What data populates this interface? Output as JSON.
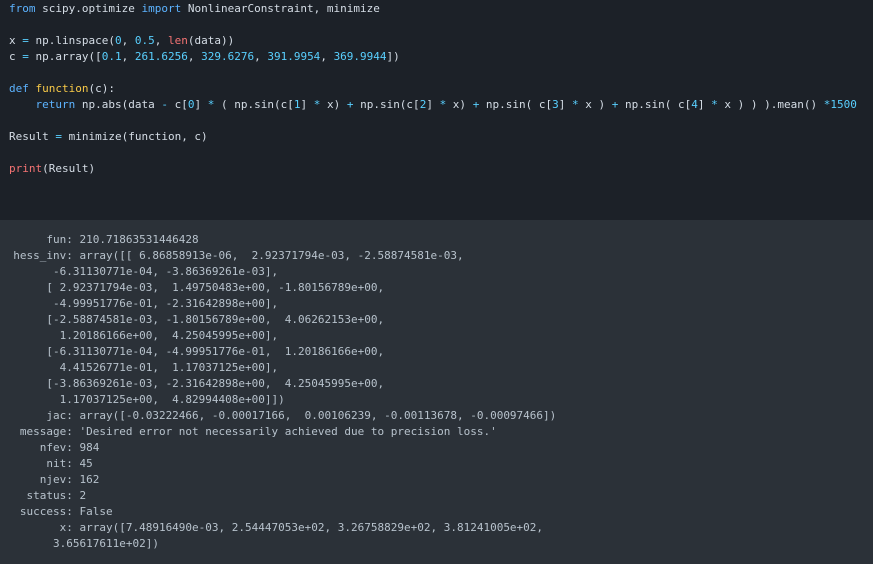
{
  "code": {
    "import_from_kw": "from",
    "import_module": " scipy.optimize ",
    "import_kw": "import",
    "import_names": " NonlinearConstraint, minimize",
    "x_prefix": "x ",
    "x_eq": "=",
    "x_mid": " np.linspace(",
    "x_a0": "0",
    "x_sep1": ", ",
    "x_a1": "0.5",
    "x_sep2": ", ",
    "x_len": "len",
    "x_end": "(data))",
    "c_prefix": "c ",
    "c_eq": "=",
    "c_mid": " np.array([",
    "c_v0": "0.1",
    "c_s0": ", ",
    "c_v1": "261.6256",
    "c_s1": ", ",
    "c_v2": "329.6276",
    "c_s2": ", ",
    "c_v3": "391.9954",
    "c_s3": ", ",
    "c_v4": "369.9944",
    "c_end": "])",
    "def_kw": "def",
    "def_space": " ",
    "def_name": "function",
    "def_args": "(c):",
    "ret_indent": "    ",
    "ret_kw": "return",
    "ret_t1": " np.abs(data ",
    "ret_minus": "-",
    "ret_t2": " c[",
    "ret_i0": "0",
    "ret_t3": "] ",
    "ret_mul1": "*",
    "ret_t4": " ( np.sin(c[",
    "ret_i1": "1",
    "ret_t5": "] ",
    "ret_mul2": "*",
    "ret_t6": " x) ",
    "ret_plus1": "+",
    "ret_t7": " np.sin(c[",
    "ret_i2": "2",
    "ret_t8": "] ",
    "ret_mul3": "*",
    "ret_t9": " x) ",
    "ret_plus2": "+",
    "ret_t10": " np.sin( c[",
    "ret_i3": "3",
    "ret_t11": "] ",
    "ret_mul4": "*",
    "ret_t12": " x ) ",
    "ret_plus3": "+",
    "ret_t13": " np.sin( c[",
    "ret_i4": "4",
    "ret_t14": "] ",
    "ret_mul5": "*",
    "ret_t15": " x ) ) ).mean() ",
    "ret_mul6": "*",
    "ret_scale": "1500",
    "res_prefix": "Result ",
    "res_eq": "=",
    "res_call": " minimize(function, c)",
    "print_kw": "print",
    "print_arg": "(Result)"
  },
  "output": {
    "lines": [
      "       fun: 210.71863531446428",
      "  hess_inv: array([[ 6.86858913e-06,  2.92371794e-03, -2.58874581e-03,",
      "        -6.31130771e-04, -3.86369261e-03],",
      "       [ 2.92371794e-03,  1.49750483e+00, -1.80156789e+00,",
      "        -4.99951776e-01, -2.31642898e+00],",
      "       [-2.58874581e-03, -1.80156789e+00,  4.06262153e+00,",
      "         1.20186166e+00,  4.25045995e+00],",
      "       [-6.31130771e-04, -4.99951776e-01,  1.20186166e+00,",
      "         4.41526771e-01,  1.17037125e+00],",
      "       [-3.86369261e-03, -2.31642898e+00,  4.25045995e+00,",
      "         1.17037125e+00,  4.82994408e+00]])",
      "       jac: array([-0.03222466, -0.00017166,  0.00106239, -0.00113678, -0.00097466])",
      "   message: 'Desired error not necessarily achieved due to precision loss.'",
      "      nfev: 984",
      "       nit: 45",
      "      njev: 162",
      "    status: 2",
      "   success: False",
      "         x: array([7.48916490e-03, 2.54447053e+02, 3.26758829e+02, 3.81241005e+02,",
      "        3.65617611e+02])"
    ]
  },
  "colors": {
    "code_bg": "#1c2128",
    "output_bg": "#2b3138",
    "keyword": "#5cb3ff",
    "function_name": "#f7c948",
    "number": "#59d0ff",
    "builtin": "#f47373",
    "text": "#d5dde6",
    "output_text": "#b7c2cc"
  }
}
